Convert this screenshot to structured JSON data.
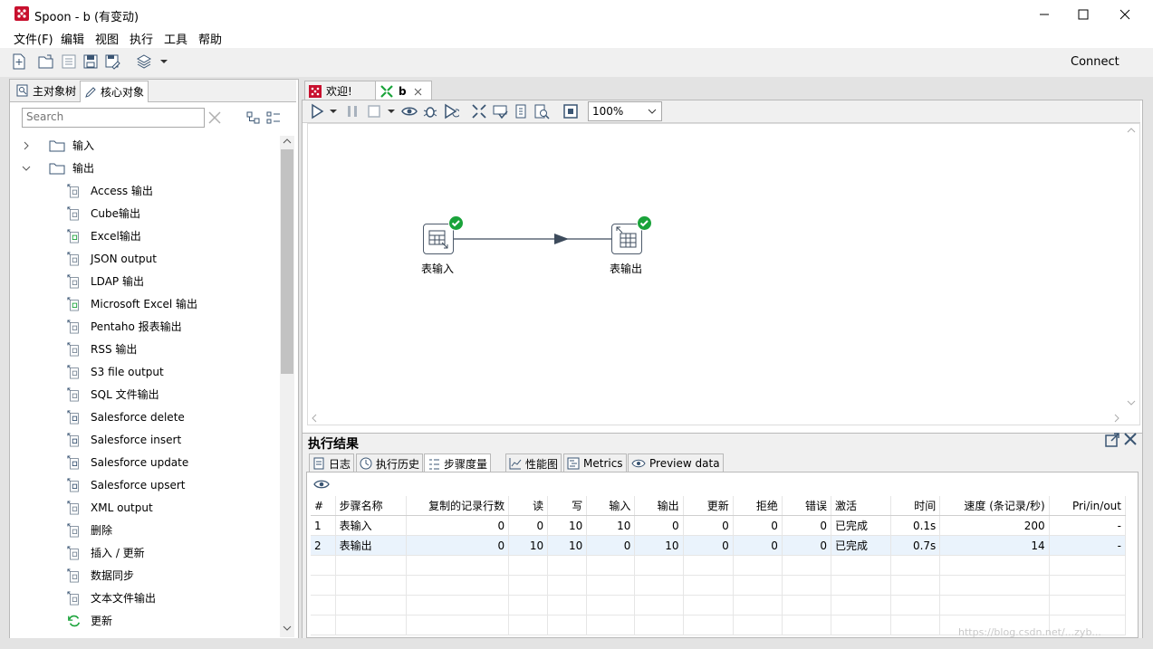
{
  "window": {
    "title": "Spoon - b (有变动)",
    "minimize_icon": "minimize-icon",
    "maximize_icon": "maximize-icon",
    "close_icon": "close-icon"
  },
  "menu": [
    "文件(F)",
    "编辑",
    "视图",
    "执行",
    "工具",
    "帮助"
  ],
  "toolbar": {
    "connect_label": "Connect",
    "icons": [
      "new-file-icon",
      "open-file-icon",
      "explore-repository-icon",
      "save-icon",
      "save-as-icon",
      "perspective-layers-icon",
      "chevron-down-icon"
    ]
  },
  "left_panel": {
    "tabs": [
      "主对象树",
      "核心对象"
    ],
    "active_tab": "核心对象",
    "search_placeholder": "Search",
    "tree": {
      "folders": [
        "输入",
        "输出"
      ],
      "output_items": [
        "Access 输出",
        "Cube输出",
        "Excel输出",
        "JSON output",
        "LDAP 输出",
        "Microsoft Excel 输出",
        "Pentaho 报表输出",
        "RSS 输出",
        "S3 file output",
        "SQL 文件输出",
        "Salesforce delete",
        "Salesforce insert",
        "Salesforce update",
        "Salesforce upsert",
        "XML output",
        "删除",
        "插入 / 更新",
        "数据同步",
        "文本文件输出",
        "更新"
      ]
    }
  },
  "editor": {
    "tabs": [
      "欢迎!",
      "b"
    ],
    "active_tab": "b",
    "zoom": "100%",
    "steps": [
      {
        "name": "表输入",
        "status": "ok"
      },
      {
        "name": "表输出",
        "status": "ok"
      }
    ],
    "hop": "表输入 → 表输出"
  },
  "results": {
    "title": "执行结果",
    "tabs": [
      "日志",
      "执行历史",
      "步骤度量",
      "性能图",
      "Metrics",
      "Preview data"
    ],
    "active_tab": "步骤度量",
    "columns": [
      "#",
      "步骤名称",
      "复制的记录行数",
      "读",
      "写",
      "输入",
      "输出",
      "更新",
      "拒绝",
      "错误",
      "激活",
      "时间",
      "速度 (条记录/秒)",
      "Pri/in/out"
    ],
    "rows": [
      [
        "1",
        "表输入",
        "0",
        "0",
        "10",
        "10",
        "0",
        "0",
        "0",
        "0",
        "已完成",
        "0.1s",
        "200",
        "-"
      ],
      [
        "2",
        "表输出",
        "0",
        "10",
        "10",
        "0",
        "10",
        "0",
        "0",
        "0",
        "已完成",
        "0.7s",
        "14",
        "-"
      ]
    ]
  },
  "watermark": "https://blog.csdn.net/...zyb..."
}
